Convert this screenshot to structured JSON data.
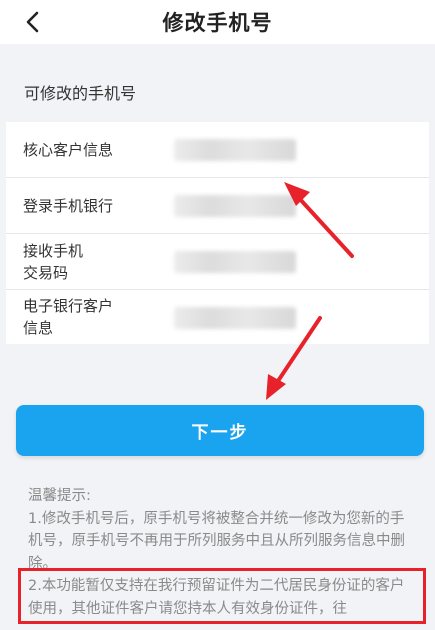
{
  "header": {
    "title": "修改手机号",
    "back_icon": "chevron-left-icon"
  },
  "section": {
    "title": "可修改的手机号"
  },
  "rows": [
    {
      "label": "核心客户信息"
    },
    {
      "label": "登录手机银行"
    },
    {
      "label": "接收手机\n交易码"
    },
    {
      "label": "电子银行客户\n信息"
    }
  ],
  "next_button": {
    "label": "下一步"
  },
  "tips": {
    "heading": "温馨提示:",
    "item1": "1.修改手机号后，原手机号将被整合并统一修改为您新的手机号，原手机号不再用于所列服务中且从所列服务信息中删除。",
    "item2": "2.本功能暂仅支持在我行预留证件为二代居民身份证的客户使用，其他证件客户请您持本人有效身份证件，往"
  },
  "colors": {
    "accent": "#1aa3ee",
    "annotation": "#e8222a",
    "background": "#f2f3f7"
  }
}
